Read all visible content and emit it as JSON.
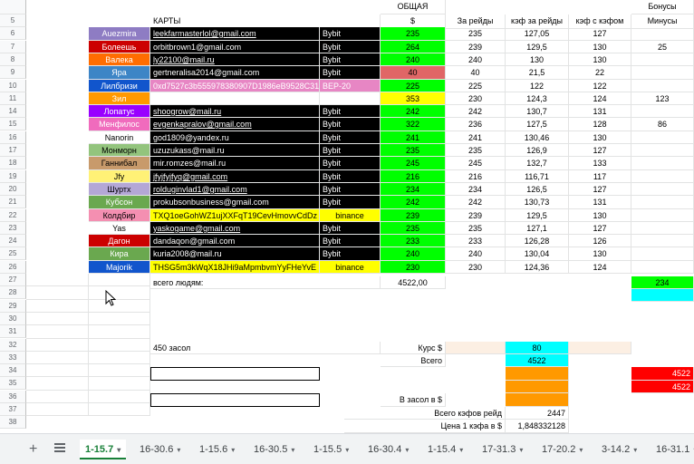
{
  "header": {
    "bonus": "Бонусы",
    "general": "ОБЩАЯ",
    "cards": "КАРТЫ",
    "dollar": "$",
    "per_raids": "За рейды",
    "coef_per_raids": "кэф за рейды",
    "coef_with_coef": "кэф с кэфом",
    "minuses": "Минусы"
  },
  "row_numbers": [
    "5",
    "6",
    "7",
    "8",
    "9",
    "10",
    "11",
    "14",
    "15",
    "16",
    "17",
    "18",
    "19",
    "20",
    "21",
    "22",
    "23",
    "24",
    "25",
    "26",
    "27",
    "28",
    "29",
    "30",
    "31",
    "32",
    "33",
    "34",
    "35",
    "36",
    "37",
    "38"
  ],
  "rows": [
    {
      "name": "Auezmira",
      "name_bg": "#8e7cc3",
      "card": "leekfarmasterlol@gmail.com",
      "link": true,
      "bank": "Bybit",
      "card_bg": "#000000",
      "card_color": "#ffffff",
      "gen": "235",
      "gen_bg": "#00ff00",
      "raids": "235",
      "coef": "127,05",
      "coef2": "127",
      "minus": ""
    },
    {
      "name": "Болеешь",
      "name_bg": "#cc0000",
      "card": "orbitbrown1@gmail.com",
      "link": false,
      "bank": "Bybit",
      "card_bg": "#000000",
      "card_color": "#ffffff",
      "gen": "264",
      "gen_bg": "#00ff00",
      "raids": "239",
      "coef": "129,5",
      "coef2": "130",
      "minus": "25"
    },
    {
      "name": "Валека",
      "name_bg": "#ff6d01",
      "card": "ly22100@mail.ru",
      "link": true,
      "bank": "Bybit",
      "card_bg": "#000000",
      "card_color": "#ffffff",
      "gen": "240",
      "gen_bg": "#00ff00",
      "raids": "240",
      "coef": "130",
      "coef2": "130",
      "minus": ""
    },
    {
      "name": "Яра",
      "name_bg": "#3d85c6",
      "card": "gertneralisa2014@gmail.com",
      "link": false,
      "bank": "Bybit",
      "card_bg": "#000000",
      "card_color": "#ffffff",
      "gen": "40",
      "gen_bg": "#e06666",
      "raids": "40",
      "coef": "21,5",
      "coef2": "22",
      "minus": ""
    },
    {
      "name": "Лилбризи",
      "name_bg": "#1155cc",
      "card": "0xd7527c3b555978380907D1986eB9528C31",
      "link": false,
      "bank": "BEP-20",
      "card_bg": "#e786c4",
      "card_color": "#ffffff",
      "gen": "225",
      "gen_bg": "#00ff00",
      "raids": "225",
      "coef": "122",
      "coef2": "122",
      "minus": ""
    },
    {
      "name": "Зил",
      "name_bg": "#ff9900",
      "card": "",
      "link": false,
      "bank": "",
      "card_bg": "#ffffff",
      "card_color": "#000000",
      "gen": "353",
      "gen_bg": "#ffff00",
      "raids": "230",
      "coef": "124,3",
      "coef2": "124",
      "minus": "123"
    },
    {
      "name": "Лопатус",
      "name_bg": "#9900ff",
      "card": "shoogrow@mail.ru",
      "link": true,
      "bank": "Bybit",
      "card_bg": "#000000",
      "card_color": "#ffffff",
      "gen": "242",
      "gen_bg": "#00ff00",
      "raids": "242",
      "coef": "130,7",
      "coef2": "131",
      "minus": ""
    },
    {
      "name": "Менфилос",
      "name_bg": "#f06bbd",
      "card": "evgenkapralov@gmail.com",
      "link": true,
      "bank": "Bybit",
      "card_bg": "#000000",
      "card_color": "#ffffff",
      "gen": "322",
      "gen_bg": "#00ff00",
      "raids": "236",
      "coef": "127,5",
      "coef2": "128",
      "minus": "86"
    },
    {
      "name": "Nanorin",
      "name_bg": "#ffffff",
      "card": "god1809@yandex.ru",
      "link": false,
      "bank": "Bybit",
      "card_bg": "#000000",
      "card_color": "#ffffff",
      "gen": "241",
      "gen_bg": "#00ff00",
      "raids": "241",
      "coef": "130,46",
      "coef2": "130",
      "minus": ""
    },
    {
      "name": "Монморн",
      "name_bg": "#93c47d",
      "card": "uzuzukass@mail.ru",
      "link": false,
      "bank": "Bybit",
      "card_bg": "#000000",
      "card_color": "#ffffff",
      "gen": "235",
      "gen_bg": "#00ff00",
      "raids": "235",
      "coef": "126,9",
      "coef2": "127",
      "minus": ""
    },
    {
      "name": "Ганнибал",
      "name_bg": "#c89a6b",
      "card": "mir.romzes@mail.ru",
      "link": false,
      "bank": "Bybit",
      "card_bg": "#000000",
      "card_color": "#ffffff",
      "gen": "245",
      "gen_bg": "#00ff00",
      "raids": "245",
      "coef": "132,7",
      "coef2": "133",
      "minus": ""
    },
    {
      "name": "Jfy",
      "name_bg": "#fff176",
      "card": "jfyjfyjfyq@gmail.com",
      "link": true,
      "bank": "Bybit",
      "card_bg": "#000000",
      "card_color": "#ffffff",
      "gen": "216",
      "gen_bg": "#00ff00",
      "raids": "216",
      "coef": "116,71",
      "coef2": "117",
      "minus": ""
    },
    {
      "name": "Шуртх",
      "name_bg": "#b4a7d6",
      "card": "rolduginvlad1@gmail.com",
      "link": true,
      "bank": "Bybit",
      "card_bg": "#000000",
      "card_color": "#ffffff",
      "gen": "234",
      "gen_bg": "#00ff00",
      "raids": "234",
      "coef": "126,5",
      "coef2": "127",
      "minus": ""
    },
    {
      "name": "Кубсон",
      "name_bg": "#6aa84f",
      "card": "prokubsonbusiness@gmail.com",
      "link": false,
      "bank": "Bybit",
      "card_bg": "#000000",
      "card_color": "#ffffff",
      "gen": "242",
      "gen_bg": "#00ff00",
      "raids": "242",
      "coef": "130,73",
      "coef2": "131",
      "minus": ""
    },
    {
      "name": "Колдбир",
      "name_bg": "#f48fb1",
      "card": "TXQ1oeGohWZ1ujXXFqT19CevHmovvCdDz",
      "link": false,
      "bank": "binance",
      "card_bg": "#ffff00",
      "card_color": "#000000",
      "gen": "239",
      "gen_bg": "#00ff00",
      "raids": "239",
      "coef": "129,5",
      "coef2": "130",
      "minus": ""
    },
    {
      "name": "Yas",
      "name_bg": "#ffffff",
      "card": "yaskogame@gmail.com",
      "link": true,
      "bank": "Bybit",
      "card_bg": "#000000",
      "card_color": "#ffffff",
      "gen": "235",
      "gen_bg": "#00ff00",
      "raids": "235",
      "coef": "127,1",
      "coef2": "127",
      "minus": ""
    },
    {
      "name": "Дагон",
      "name_bg": "#cc0000",
      "card": "dandaqon@gmail.com",
      "link": false,
      "bank": "Bybit",
      "card_bg": "#000000",
      "card_color": "#ffffff",
      "gen": "233",
      "gen_bg": "#00ff00",
      "raids": "233",
      "coef": "126,28",
      "coef2": "126",
      "minus": ""
    },
    {
      "name": "Кира",
      "name_bg": "#6aa84f",
      "card": "kuria2008@mail.ru",
      "link": false,
      "bank": "Bybit",
      "card_bg": "#000000",
      "card_color": "#ffffff",
      "gen": "240",
      "gen_bg": "#00ff00",
      "raids": "240",
      "coef": "130,04",
      "coef2": "130",
      "minus": ""
    },
    {
      "name": "Majorik",
      "name_bg": "#1155cc",
      "card": "THSG5m3kWqX18JHi9aMpmbvmYyFHeYvE",
      "link": false,
      "bank": "binance",
      "card_bg": "#ffff00",
      "card_color": "#000000",
      "gen": "230",
      "gen_bg": "#00ff00",
      "raids": "230",
      "coef": "124,36",
      "coef2": "124",
      "minus": ""
    }
  ],
  "summary": {
    "total_people_label": "всего людям:",
    "total_people_value": "4522,00",
    "bonus_total": "234",
    "sasol_label": "450 засол",
    "rate_label": "Курс $",
    "rate_value": "80",
    "total_label": "Всего",
    "total_value": "4522",
    "right_value1": "4522",
    "right_value2": "4522",
    "in_sasol_label": "В засол в $",
    "coef_total_label": "Всего кэфов  рейд",
    "coef_total_value": "2447",
    "coef_price_label": "Цена 1 кэфа в $",
    "coef_price_value": "1,848332128"
  },
  "tabs": [
    "1-15.7",
    "16-30.6",
    "1-15.6",
    "16-30.5",
    "1-15.5",
    "16-30.4",
    "1-15.4",
    "17-31.3",
    "17-20.2",
    "3-14.2",
    "16-31.1"
  ],
  "active_tab": "1-15.7",
  "colors": {
    "green": "#00ff00",
    "orange": "#ff9900",
    "cyan": "#00ffff",
    "red": "#ff0000",
    "peach": "#fcefe3"
  }
}
